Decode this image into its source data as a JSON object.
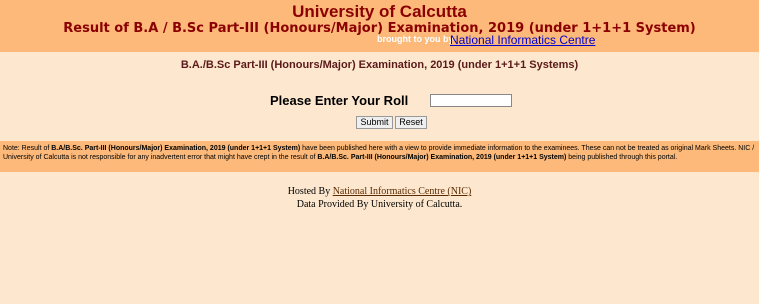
{
  "header": {
    "university": "University of Calcutta",
    "result_title": "Result of B.A / B.Sc Part-III (Honours/Major) Examination, 2019 (under 1+1+1 System)",
    "brought_label": "brought to you by",
    "nic_link": "National Informatics Centre"
  },
  "subtitle": "B.A./B.Sc Part-III (Honours/Major) Examination, 2019 (under 1+1+1 Systems)",
  "form": {
    "roll_label": "Please Enter Your Roll",
    "roll_value": "",
    "submit_label": "Submit",
    "reset_label": "Reset"
  },
  "note": {
    "prefix": "Note: Result of ",
    "exam_bold_1": "B.A/B.Sc. Part-III (Honours/Major) Examination, 2019 (under 1+1+1 System)",
    "middle": " have been published here with a view to provide immediate information to the examinees. These can not be treated as original Mark Sheets. NIC / University of Calcutta is not responsible for any inadvertent error that might have crept in the result of ",
    "exam_bold_2": "B.A/B.Sc. Part-III (Honours/Major) Examination, 2019 (under 1+1+1 System)",
    "suffix": " being published through this portal."
  },
  "footer": {
    "hosted_prefix": "Hosted By",
    "hosted_link": "National Informatics Centre (NIC)",
    "data_line": "Data Provided By University of Calcutta."
  }
}
